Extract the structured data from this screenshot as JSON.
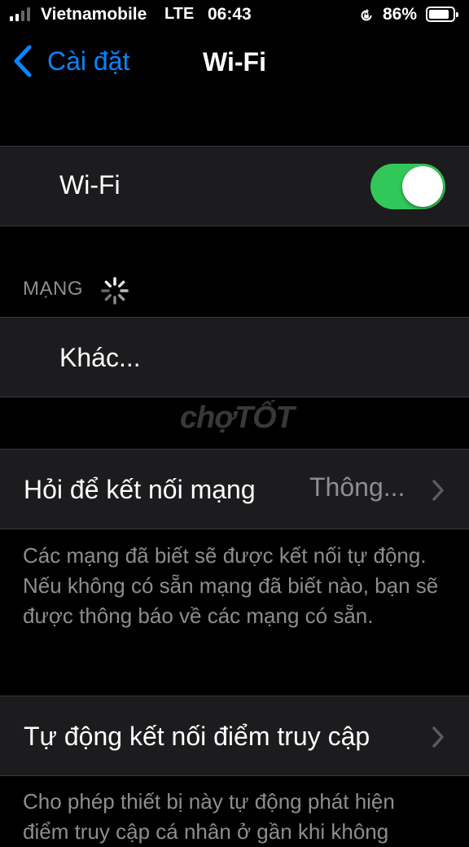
{
  "status_bar": {
    "carrier": "Vietnamobile",
    "network": "LTE",
    "time": "06:43",
    "battery_percent": "86%",
    "battery_level": 0.86
  },
  "nav": {
    "back_label": "Cài đặt",
    "title": "Wi-Fi"
  },
  "wifi_row": {
    "label": "Wi-Fi",
    "enabled": true
  },
  "networks_section": {
    "header": "MẠNG",
    "other_label": "Khác..."
  },
  "watermark": "chợTỐT",
  "ask_to_join": {
    "label": "Hỏi để kết nối mạng",
    "value": "Thông...",
    "footer": "Các mạng đã biết sẽ được kết nối tự động. Nếu không có sẵn mạng đã biết nào, bạn sẽ được thông báo về các mạng có sẵn."
  },
  "auto_join_hotspot": {
    "label": "Tự động kết nối điểm truy cập",
    "footer": "Cho phép thiết bị này tự động phát hiện điểm truy cập cá nhân ở gần khi không"
  },
  "colors": {
    "accent": "#0a84ff",
    "toggle_on": "#32c759",
    "cell_bg": "#1c1c1e",
    "secondary_text": "#8d8d92"
  }
}
